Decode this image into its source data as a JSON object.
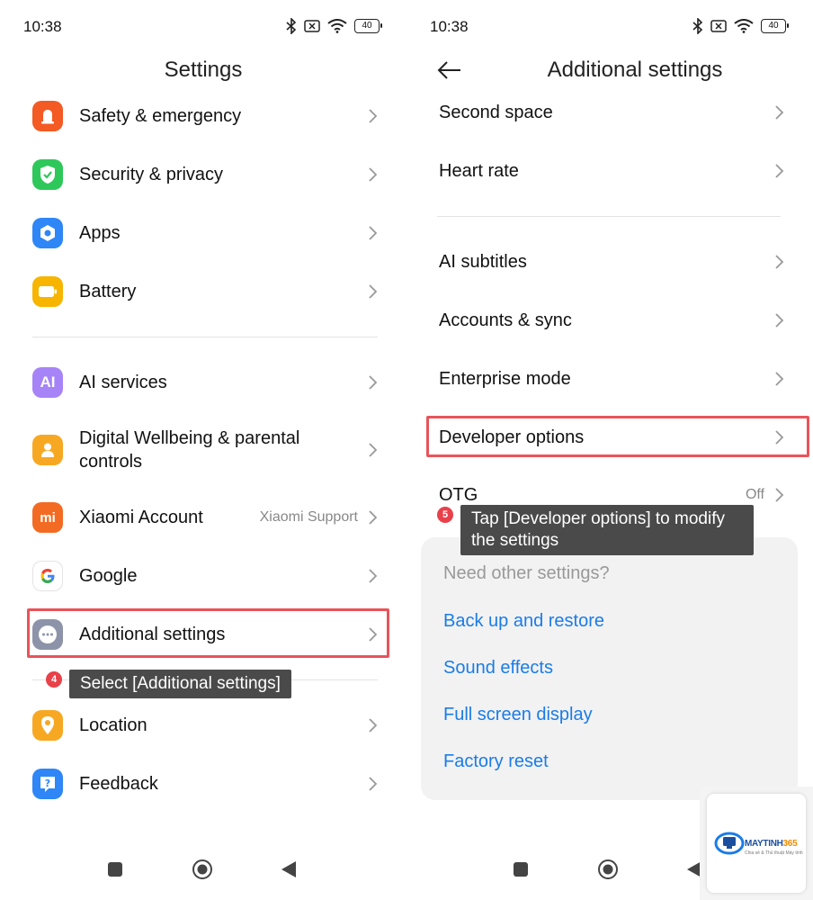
{
  "left": {
    "status": {
      "time": "10:38",
      "battery": "40"
    },
    "title": "Settings",
    "items": [
      {
        "label": "Safety & emergency",
        "icon": "siren-icon",
        "color": "#f35a24"
      },
      {
        "label": "Security & privacy",
        "icon": "shield-check-icon",
        "color": "#2ec85a"
      },
      {
        "label": "Apps",
        "icon": "apps-hexagon-icon",
        "color": "#2f86f6"
      },
      {
        "label": "Battery",
        "icon": "battery-icon",
        "color": "#f7b500"
      },
      {
        "label": "AI services",
        "icon": "ai-icon",
        "color": "#a684f7"
      },
      {
        "label": "Digital Wellbeing & parental controls",
        "icon": "wellbeing-person-icon",
        "color": "#f7a823"
      },
      {
        "label": "Xiaomi Account",
        "sub": "Xiaomi Support",
        "icon": "mi-logo-icon",
        "color": "#f36b23"
      },
      {
        "label": "Google",
        "icon": "google-g-icon",
        "color": "#ffffff"
      },
      {
        "label": "Additional settings",
        "icon": "more-dots-icon",
        "color": "#8d93a8"
      },
      {
        "label": "Location",
        "icon": "location-pin-icon",
        "color": "#f7a823"
      },
      {
        "label": "Feedback",
        "icon": "feedback-question-icon",
        "color": "#2f86f6"
      }
    ],
    "step": {
      "number": "4",
      "text": "Select [Additional settings]"
    }
  },
  "right": {
    "status": {
      "time": "10:38",
      "battery": "40"
    },
    "title": "Additional settings",
    "items": [
      {
        "label": "Second space"
      },
      {
        "label": "Heart rate"
      },
      {
        "label": "AI subtitles"
      },
      {
        "label": "Accounts & sync"
      },
      {
        "label": "Enterprise mode"
      },
      {
        "label": "Developer options"
      },
      {
        "label": "OTG",
        "sub": "Off"
      }
    ],
    "step": {
      "number": "5",
      "text": "Tap [Developer options] to modify the settings"
    },
    "suggest": {
      "title": "Need other settings?",
      "links": [
        "Back up and restore",
        "Sound effects",
        "Full screen display",
        "Factory reset"
      ]
    }
  },
  "watermark": {
    "brand": "MAYTINH",
    "brand_num": "365",
    "tagline": "Chia sẻ & Thủ thuật Máy tính"
  },
  "colors": {
    "highlight": "#e8545a",
    "link": "#1a7ce8",
    "tooltip_bg": "#4a4a4a",
    "badge": "#e8414a"
  }
}
